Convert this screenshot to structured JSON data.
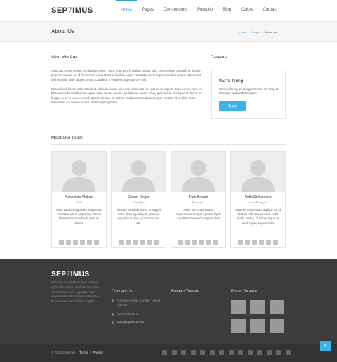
{
  "brand": {
    "logo_pre": "SEP",
    "logo_seven": "7",
    "logo_post": "IMUS"
  },
  "nav": {
    "items": [
      {
        "label": "Home",
        "active": true
      },
      {
        "label": "Pages"
      },
      {
        "label": "Components"
      },
      {
        "label": "Portfolio"
      },
      {
        "label": "Blog"
      },
      {
        "label": "Colors"
      },
      {
        "label": "Contact"
      }
    ]
  },
  "page": {
    "title": "About Us",
    "breadcrumb": [
      "Home",
      "Pages",
      "About Us"
    ]
  },
  "who": {
    "heading": "Who We Are",
    "p1": "Fusce ac lectus neque, eu dapibus risus. Fusce ut tortor mi. Nullam augue nibh, cursus vitae convallis in, iaculis pharetra mauris. Ut id fermentum urna. Nunc at facilisis turpis. Curabitur scelerisque convallis ornare. Maecenas sed nisl nisl, vitae aliquet metus. Curabitur a velit felis, eget ultrices nisi.",
    "p2": "Phasellus in libero tortor. Etiam et vehicula ipsum. Sed nec nunc justo. In eget lacus sapien. Cras ac nisi eros, eu bibendum elit. Sed lacinia, augue vitae cursus iaculis, ligula lacus ornare risus, quis lacinia nisi ligula ut libero. In feugiat sem eu urna eleifend at pellentesque mi dictum. Nullam ac leo diam semper porttitor et id nibh. Nunc sollicitudin accumsan mauris ullamcorper gravida."
  },
  "careers": {
    "heading": "Careers",
    "hiring_title": "We're hiring",
    "hiring_text": "We're offering great opportunities for Project Manager and Web Designer.",
    "apply_label": "Apply"
  },
  "team": {
    "heading": "Meet Our Team",
    "members": [
      {
        "name": "Sebastian Stokes",
        "role": "CEO",
        "bio": "Nulla dapibus dignissim adipiscing. Tincidunt luctus adipiscing. Donec sit amet tortor eu ligula pretium viverra."
      },
      {
        "name": "Robert Singer",
        "role": "Developer",
        "bio": "Aliquam sed nibh lorem, at sagittis enim. Cras ligula ligula, placerat eu pulvinar vitae, accumsan nec elit."
      },
      {
        "name": "Liam Bowen",
        "role": "Developer",
        "bio": "Donec vel lectus massa. Suspendisse tempor egestas ligula ut porttitor. Praesent et ipsum felis."
      },
      {
        "name": "Sofia Richardson",
        "role": "Lead Designer",
        "bio": "Vivamus elementum dapibus mi, id facilisis velit aliquam sed. Nulla mollis sapien, id adipiscing at sit amet sapien sapien nulla."
      }
    ]
  },
  "footer": {
    "about_text": "Sed eros orci, pellentesque congue eget, elementum nec eros. Convallis vel mauris ac felis vulputate. Nam aliquet est volutpat. Proin sollicitudin dui sit amet justo eleifend sagittis.",
    "contact_heading": "Contact Us",
    "address": "221 Baker Street, London, United Kingdom",
    "phone": "(000) 1234 5678",
    "email": "hello@septimus.com",
    "tweets_heading": "Recent Tweets",
    "photos_heading": "Photo Stream",
    "copyright": "© 2013 Septimus |",
    "terms": "Terms",
    "sep": "|",
    "privacy": "Privacy"
  },
  "icons": {
    "social": [
      "facebook-icon",
      "twitter-icon",
      "google-plus-icon",
      "linkedin-icon",
      "skype-icon",
      "email-icon"
    ],
    "footer_social": [
      "facebook-icon",
      "twitter-icon",
      "google-plus-icon",
      "linkedin-icon",
      "pinterest-icon",
      "youtube-icon",
      "rss-icon",
      "dribbble-icon",
      "github-icon",
      "instagram-icon",
      "vimeo-icon",
      "flickr-icon",
      "tumblr-icon",
      "linkedin-icon"
    ]
  },
  "colors": {
    "accent": "#3498db",
    "button": "#3bb3e8",
    "footer": "#3c3c3c"
  }
}
